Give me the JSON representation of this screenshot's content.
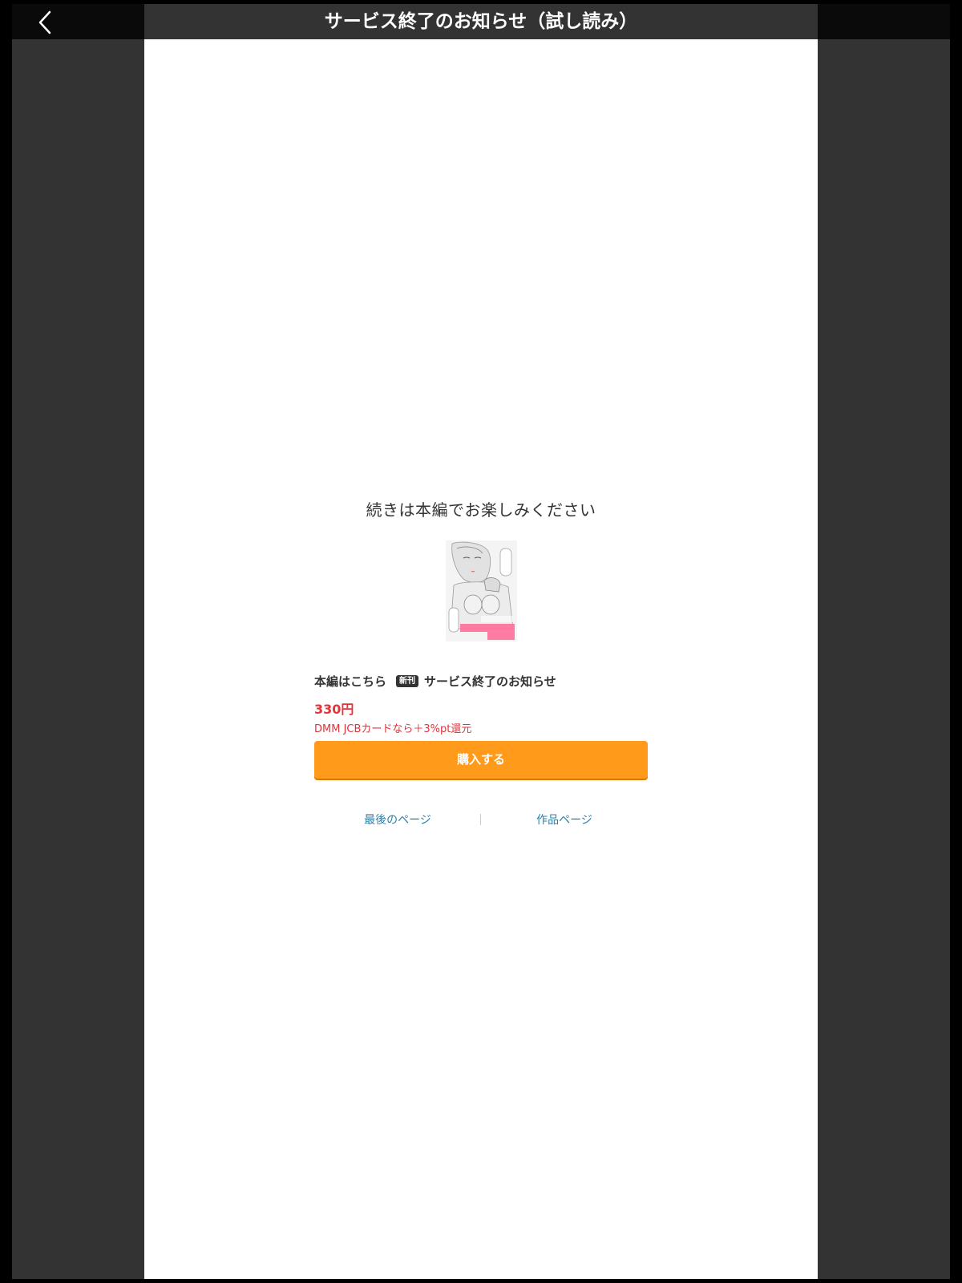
{
  "header": {
    "title": "サービス終了のお知らせ（試し読み）",
    "back_icon": "chevron-left-icon"
  },
  "end_page": {
    "continue_text": "続きは本編でお楽しみください",
    "cover_image": "book-cover",
    "cover_text": "サービス終了のお知らせ",
    "main_link_label": "本編はこちら",
    "new_badge": "新刊",
    "book_title": "サービス終了のお知らせ",
    "price": "330円",
    "campaign": "DMM JCBカードなら＋3%pt還元",
    "buy_button": "購入する",
    "links": {
      "last_page": "最後のページ",
      "work_page": "作品ページ"
    }
  },
  "colors": {
    "background": "#000000",
    "viewer": "#333333",
    "header_side": "#0a0a0a",
    "page": "#ffffff",
    "accent_orange": "#ff9a1a",
    "price_red": "#e3333a",
    "link_blue": "#2d7fa8"
  }
}
